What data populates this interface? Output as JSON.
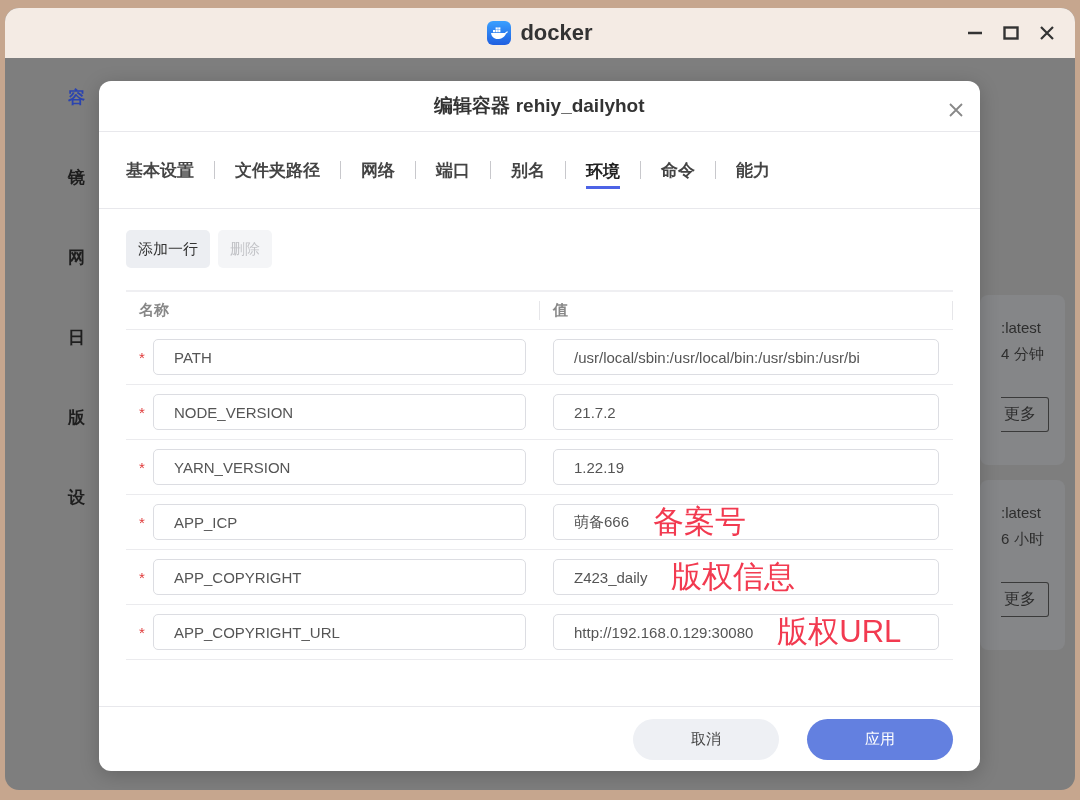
{
  "window": {
    "title": "docker"
  },
  "sidebar": {
    "items": [
      {
        "label": "容",
        "selected": true
      },
      {
        "label": "镜",
        "selected": false
      },
      {
        "label": "网",
        "selected": false
      },
      {
        "label": "日",
        "selected": false
      },
      {
        "label": "版",
        "selected": false
      },
      {
        "label": "设",
        "selected": false
      }
    ]
  },
  "cards": [
    {
      "image": ":latest",
      "time": "4 分钟",
      "button": "更多"
    },
    {
      "image": ":latest",
      "time": "6 小时",
      "button": "更多"
    }
  ],
  "dialog": {
    "title": "编辑容器 rehiy_dailyhot",
    "tabs": [
      {
        "label": "基本设置",
        "selected": false
      },
      {
        "label": "文件夹路径",
        "selected": false
      },
      {
        "label": "网络",
        "selected": false
      },
      {
        "label": "端口",
        "selected": false
      },
      {
        "label": "别名",
        "selected": false
      },
      {
        "label": "环境",
        "selected": true
      },
      {
        "label": "命令",
        "selected": false
      },
      {
        "label": "能力",
        "selected": false
      }
    ],
    "toolbar": [
      {
        "label": "添加一行",
        "disabled": false
      },
      {
        "label": "删除",
        "disabled": true
      }
    ],
    "table": {
      "columns": [
        "名称",
        "值"
      ],
      "rows": [
        {
          "marker": "*",
          "name": "PATH",
          "value": "/usr/local/sbin:/usr/local/bin:/usr/sbin:/usr/bi"
        },
        {
          "marker": "*",
          "name": "NODE_VERSION",
          "value": "21.7.2"
        },
        {
          "marker": "*",
          "name": "YARN_VERSION",
          "value": "1.22.19"
        },
        {
          "marker": "*",
          "name": "APP_ICP",
          "value": "萌备666",
          "annotation": "备案号"
        },
        {
          "marker": "*",
          "name": "APP_COPYRIGHT",
          "value": "Z423_daily",
          "annotation": "版权信息"
        },
        {
          "marker": "*",
          "name": "APP_COPYRIGHT_URL",
          "value": "http://192.168.0.129:30080",
          "annotation": "版权URL"
        }
      ]
    },
    "buttons": [
      {
        "label": "取消",
        "kind": "secondary"
      },
      {
        "label": "应用",
        "kind": "primary"
      }
    ]
  }
}
